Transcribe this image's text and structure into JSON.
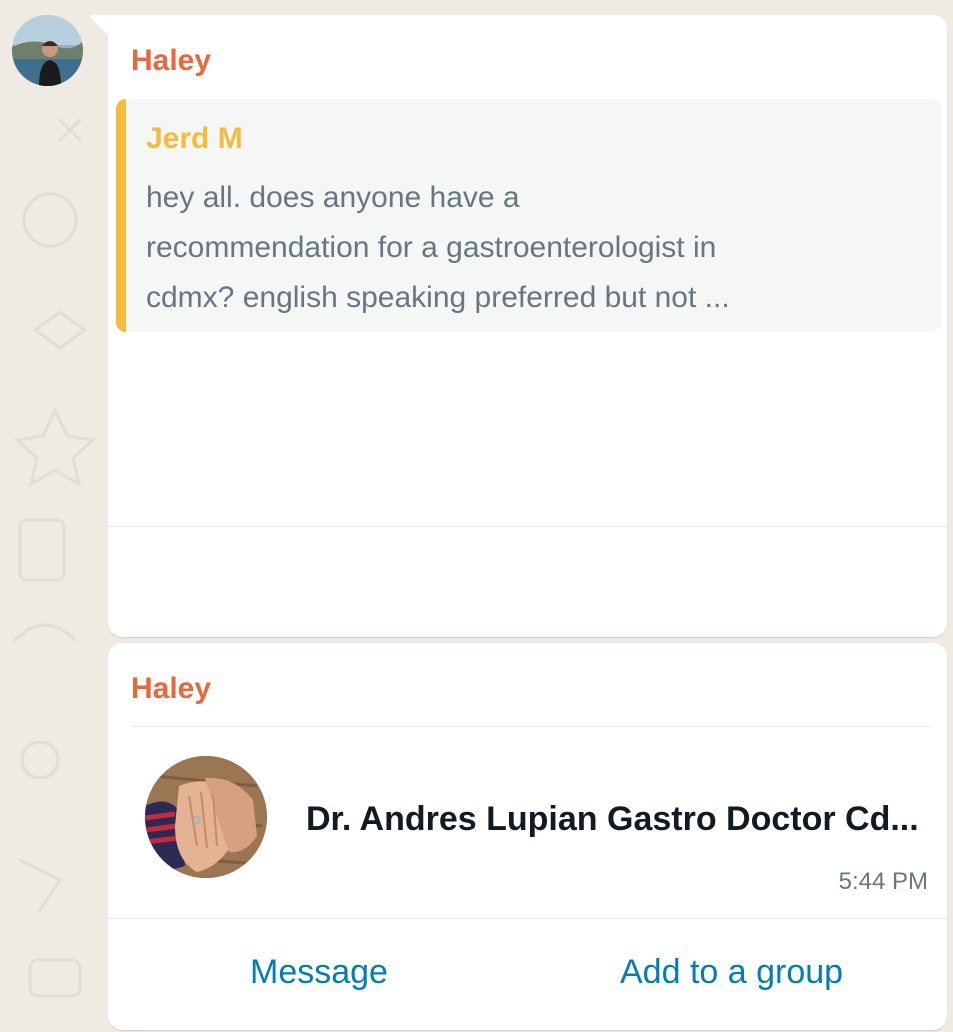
{
  "messages": [
    {
      "sender": "Haley",
      "quoted": {
        "author": "Jerd M",
        "lines": [
          "hey all. does anyone have a",
          "recommendation for a gastroenterologist in",
          "cdmx? english speaking preferred but not ..."
        ]
      }
    },
    {
      "sender": "Haley",
      "contact_card": {
        "name": "Dr. Andres Lupian Gastro Doctor Cd...",
        "time": "5:44 PM",
        "actions": {
          "message": "Message",
          "add_to_group": "Add to a group"
        }
      }
    }
  ],
  "colors": {
    "sender_name": "#e8673c",
    "quote_accent": "#f5bb3c",
    "link": "#027eb5",
    "chat_background": "#efeae2"
  }
}
